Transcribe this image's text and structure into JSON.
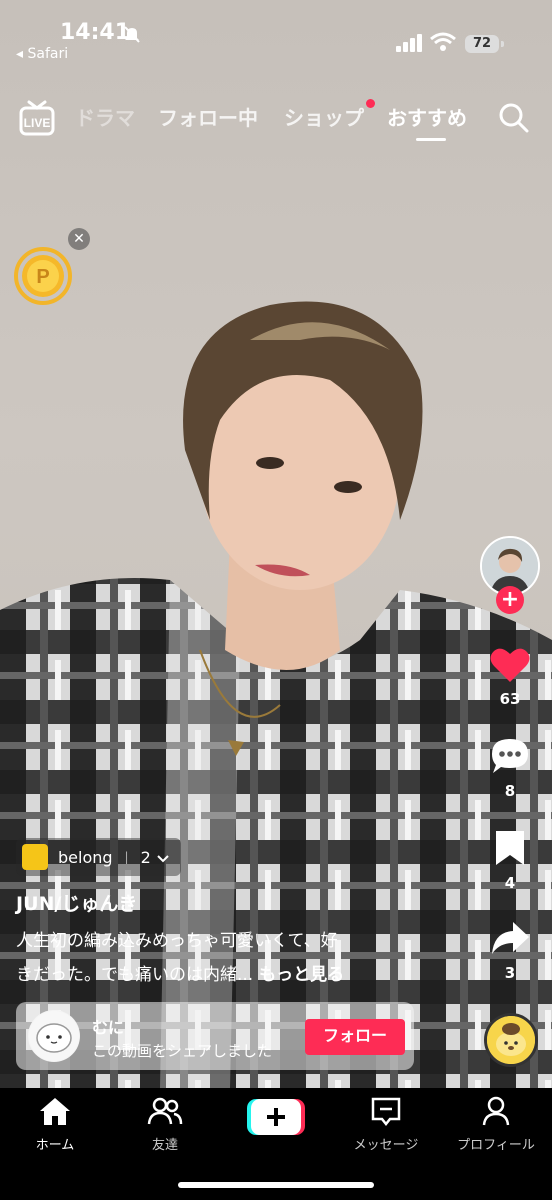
{
  "status_bar": {
    "time": "14:41",
    "back_app": "◂ Safari",
    "battery": "72"
  },
  "top_nav": {
    "tabs": [
      {
        "label": "ドラマ"
      },
      {
        "label": "フォロー中"
      },
      {
        "label": "ショップ"
      },
      {
        "label": "おすすめ"
      }
    ],
    "active_tab": "おすすめ"
  },
  "right_rail": {
    "likes": "63",
    "comments": "8",
    "saves": "4",
    "shares": "3"
  },
  "video": {
    "playlist_name": "belong",
    "playlist_count": "2",
    "username": "JUN/じゅんき",
    "caption_line1": "人生初の編み込みめっちゃ可愛いくて、好",
    "caption_line2": "きだった。でも痛いのは内緒...",
    "more_label": " もっと見る"
  },
  "share_notice": {
    "name": "むに",
    "text": "この動画をシェアしました",
    "follow_label": "フォロー"
  },
  "bottom_nav": {
    "items": [
      {
        "label": "ホーム"
      },
      {
        "label": "友達"
      },
      {
        "label": "メッセージ"
      },
      {
        "label": "プロフィール"
      }
    ]
  },
  "colors": {
    "accent": "#fe2c55",
    "background": "#000000"
  }
}
